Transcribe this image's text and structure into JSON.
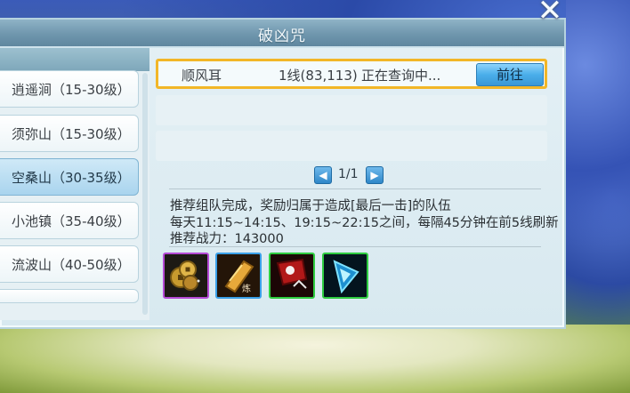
{
  "dialog": {
    "title": "破凶咒",
    "close_icon": "close-x-icon"
  },
  "sidebar": {
    "items": [
      {
        "label": "逍遥涧（15-30级）",
        "active": false
      },
      {
        "label": "须弥山（15-30级）",
        "active": false
      },
      {
        "label": "空桑山（30-35级）",
        "active": true
      },
      {
        "label": "小池镇（35-40级）",
        "active": false
      },
      {
        "label": "流波山（40-50级）",
        "active": false
      }
    ]
  },
  "results": {
    "rows": [
      {
        "name": "顺风耳",
        "line": "1线(83,113)",
        "status": "正在查询中...",
        "button": "前往"
      }
    ]
  },
  "pager": {
    "prev_icon": "chevron-left-icon",
    "text": "1/1",
    "next_icon": "chevron-right-icon"
  },
  "info": {
    "line1": "推荐组队完成，奖励归属于造成[最后一击]的队伍",
    "line2": "每天11:15~14:15、19:15~22:15之间，每隔45分钟在前5线刷新",
    "line3": "推荐战力：143000"
  },
  "rewards": [
    {
      "icon": "coins-icon",
      "border": "#b54ad6"
    },
    {
      "icon": "scroll-icon",
      "border": "#3aa0e8"
    },
    {
      "icon": "red-item-icon",
      "border": "#2ecc40"
    },
    {
      "icon": "blue-crystal-icon",
      "border": "#2ecc40"
    }
  ],
  "colors": {
    "highlight": "#f2b627",
    "button": "#4aaeea"
  }
}
